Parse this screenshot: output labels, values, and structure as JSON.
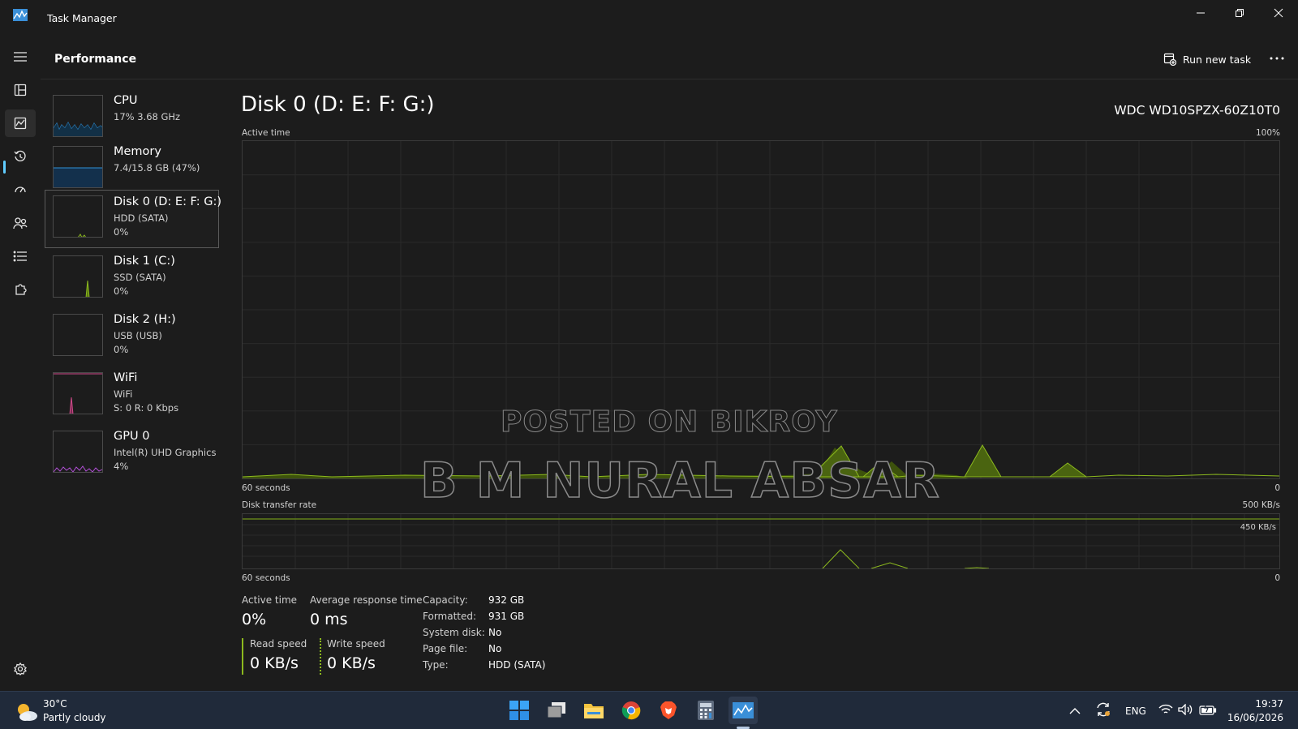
{
  "window": {
    "title": "Task Manager"
  },
  "header": {
    "page_title": "Performance",
    "run_new_task": "Run new task"
  },
  "devices": [
    {
      "name": "CPU",
      "line1": "17% 3.68 GHz",
      "line2": ""
    },
    {
      "name": "Memory",
      "line1": "7.4/15.8 GB (47%)",
      "line2": ""
    },
    {
      "name": "Disk 0 (D: E: F: G:)",
      "line1": "HDD (SATA)",
      "line2": "0%"
    },
    {
      "name": "Disk 1 (C:)",
      "line1": "SSD (SATA)",
      "line2": "0%"
    },
    {
      "name": "Disk 2 (H:)",
      "line1": "USB (USB)",
      "line2": "0%"
    },
    {
      "name": "WiFi",
      "line1": "WiFi",
      "line2": "S: 0 R: 0 Kbps"
    },
    {
      "name": "GPU 0",
      "line1": "Intel(R) UHD Graphics",
      "line2": "4%"
    }
  ],
  "main": {
    "title": "Disk 0 (D: E: F: G:)",
    "model": "WDC WD10SPZX-60Z10T0",
    "active_graph": {
      "label": "Active time",
      "max": "100%",
      "time": "60 seconds",
      "min": "0"
    },
    "transfer_graph": {
      "label": "Disk transfer rate",
      "max": "500 KB/s",
      "mid": "450 KB/s",
      "time": "60 seconds",
      "min": "0"
    },
    "watermark_line1": "POSTED ON BIKROY",
    "watermark_line2": "B M NURAL ABSAR",
    "stats": {
      "active_time_label": "Active time",
      "active_time_value": "0%",
      "avg_response_label": "Average response time",
      "avg_response_value": "0 ms",
      "read_label": "Read speed",
      "read_value": "0 KB/s",
      "write_label": "Write speed",
      "write_value": "0 KB/s"
    },
    "info": [
      {
        "k": "Capacity:",
        "v": "932 GB"
      },
      {
        "k": "Formatted:",
        "v": "931 GB"
      },
      {
        "k": "System disk:",
        "v": "No"
      },
      {
        "k": "Page file:",
        "v": "No"
      },
      {
        "k": "Type:",
        "v": "HDD (SATA)"
      }
    ]
  },
  "taskbar": {
    "temp": "30°C",
    "weather": "Partly cloudy",
    "lang": "ENG",
    "time": "19:37",
    "date": "16/06/2026"
  },
  "colors": {
    "disk_graph": "#8cb91e",
    "cpu_graph": "#2f8fd6",
    "wifi_graph": "#d04a8a",
    "gpu_graph": "#b14fd6",
    "accent": "#60cdff"
  }
}
